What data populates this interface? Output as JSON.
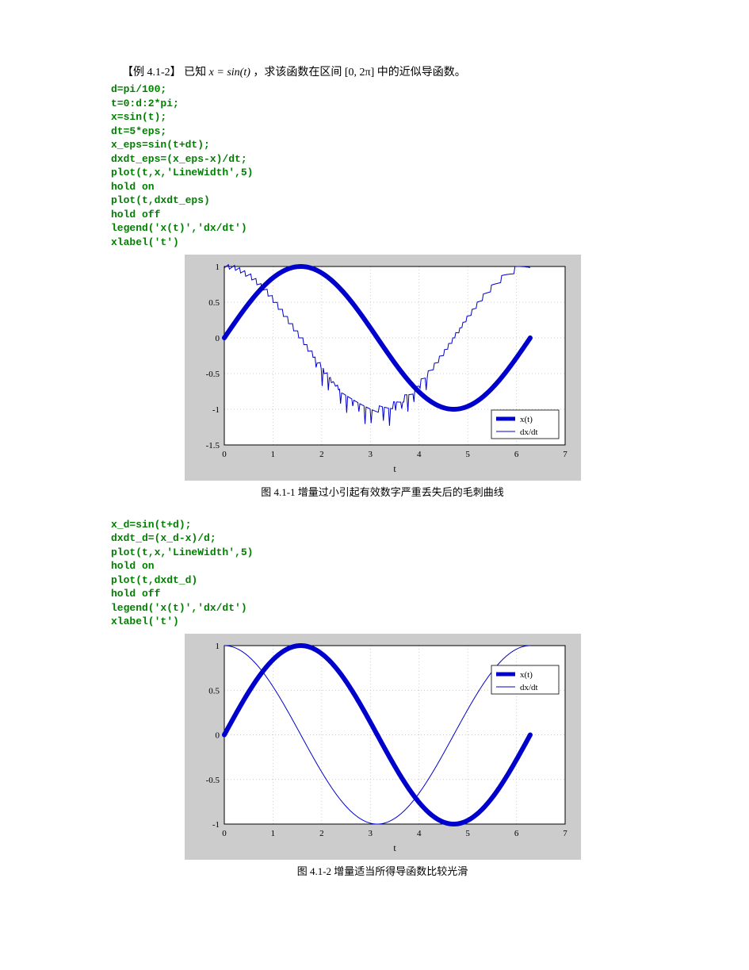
{
  "intro": {
    "label": "【例 4.1-2】",
    "text_before": "已知",
    "formula": "x = sin(t)",
    "text_mid": "，求该函数在区间",
    "interval": "[0, 2π]",
    "text_after": "中的近似导函数。"
  },
  "code1": "d=pi/100;\nt=0:d:2*pi;\nx=sin(t);\ndt=5*eps;\nx_eps=sin(t+dt);\ndxdt_eps=(x_eps-x)/dt;\nplot(t,x,'LineWidth',5)\nhold on\nplot(t,dxdt_eps)\nhold off\nlegend('x(t)','dx/dt')\nxlabel('t')",
  "figure1": {
    "caption": "图 4.1-1  增量过小引起有效数字严重丢失后的毛刺曲线"
  },
  "code2": "x_d=sin(t+d);\ndxdt_d=(x_d-x)/d;\nplot(t,x,'LineWidth',5)\nhold on\nplot(t,dxdt_d)\nhold off\nlegend('x(t)','dx/dt')\nxlabel('t')",
  "figure2": {
    "caption": "图 4.1-2  增量适当所得导函数比较光滑"
  },
  "chart_data": [
    {
      "type": "line",
      "title": "",
      "xlabel": "t",
      "ylabel": "",
      "xlim": [
        0,
        7
      ],
      "ylim": [
        -1.5,
        1
      ],
      "xticks": [
        0,
        1,
        2,
        3,
        4,
        5,
        6,
        7
      ],
      "yticks": [
        -1.5,
        -1,
        -0.5,
        0,
        0.5,
        1
      ],
      "legend": [
        "x(t)",
        "dx/dt"
      ],
      "legend_pos": "lower-right",
      "series": [
        {
          "name": "x(t)",
          "formula": "sin(t)",
          "t_range": [
            0,
            6.283
          ],
          "linewidth": 5
        },
        {
          "name": "dx/dt",
          "formula": "cos(t) with numerical noise (jagged)",
          "t_range": [
            0,
            6.283
          ],
          "linewidth": 1,
          "noisy": true
        }
      ]
    },
    {
      "type": "line",
      "title": "",
      "xlabel": "t",
      "ylabel": "",
      "xlim": [
        0,
        7
      ],
      "ylim": [
        -1,
        1
      ],
      "xticks": [
        0,
        1,
        2,
        3,
        4,
        5,
        6,
        7
      ],
      "yticks": [
        -1,
        -0.5,
        0,
        0.5,
        1
      ],
      "legend": [
        "x(t)",
        "dx/dt"
      ],
      "legend_pos": "upper-right",
      "series": [
        {
          "name": "x(t)",
          "formula": "sin(t)",
          "t_range": [
            0,
            6.283
          ],
          "linewidth": 5
        },
        {
          "name": "dx/dt",
          "formula": "cos(t)",
          "t_range": [
            0,
            6.283
          ],
          "linewidth": 1,
          "noisy": false
        }
      ]
    }
  ],
  "colors": {
    "blue": "#0000cc",
    "grid": "#cccccc",
    "axes": "#000000"
  }
}
